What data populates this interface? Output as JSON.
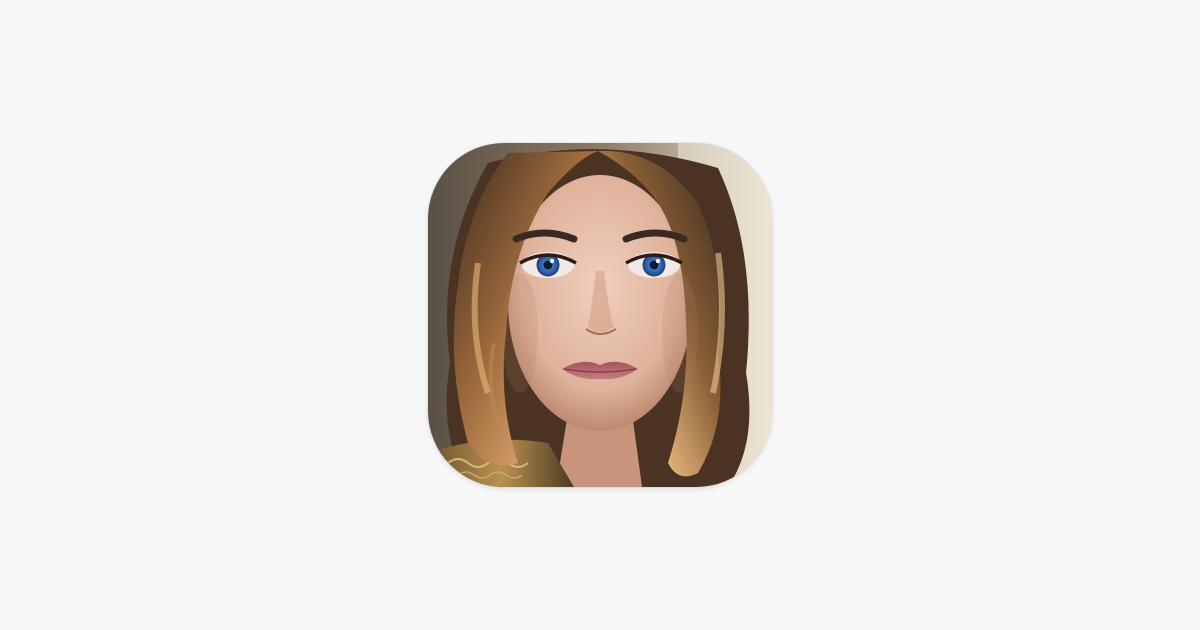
{
  "page": {
    "background_color": "#f7f7f7"
  },
  "app_icon": {
    "icon": "portrait-artwork-icon",
    "description_colors": {
      "hair": "#6b4a2c",
      "hair_highlight": "#d9a66b",
      "skin": "#e8c2ad",
      "eyes": "#3f7fd6",
      "lips": "#b8646d",
      "garment": "#8a6a3a"
    }
  }
}
